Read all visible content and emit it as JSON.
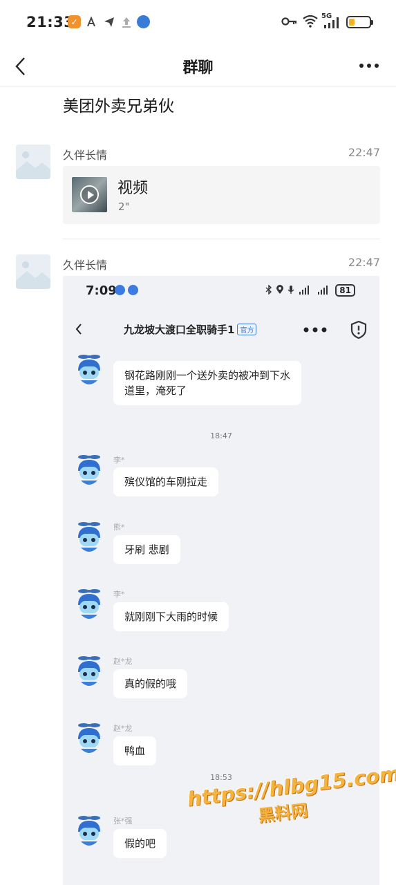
{
  "status_bar": {
    "time": "21:33",
    "network": "5G",
    "battery_level": 0.3
  },
  "header": {
    "title": "群聊",
    "back_icon": "chevron-left-icon",
    "more_icon": "more-horizontal-icon"
  },
  "group_name": "美团外卖兄弟伙",
  "messages": [
    {
      "sender": "久伴长情",
      "time": "22:47",
      "type": "video",
      "title": "视频",
      "duration": "2\""
    },
    {
      "sender": "久伴长情",
      "time": "22:47",
      "type": "image"
    }
  ],
  "screenshot": {
    "time": "7:09",
    "battery": "81",
    "chat_title": "九龙坡大渡口全职骑手1",
    "official_badge": "官方",
    "items": [
      {
        "kind": "msg",
        "name": "",
        "text_lines": [
          "钢花路刚刚一个送外卖的被冲到下水",
          "道里，淹死了"
        ]
      },
      {
        "kind": "stamp",
        "text": "18:47"
      },
      {
        "kind": "msg",
        "name": "李*",
        "text_lines": [
          "殡仪馆的车刚拉走"
        ]
      },
      {
        "kind": "msg",
        "name": "熊*",
        "text_lines": [
          "牙刷 悲剧"
        ]
      },
      {
        "kind": "msg",
        "name": "李*",
        "text_lines": [
          "就刚刚下大雨的时候"
        ]
      },
      {
        "kind": "msg",
        "name": "赵*龙",
        "text_lines": [
          "真的假的哦"
        ]
      },
      {
        "kind": "msg",
        "name": "赵*龙",
        "text_lines": [
          "鸭血"
        ]
      },
      {
        "kind": "stamp",
        "text": "18:53"
      },
      {
        "kind": "msg",
        "name": "张*强",
        "text_lines": [
          "假的吧"
        ]
      }
    ]
  },
  "watermark": {
    "url": "https://hlbg15.com",
    "label": "黑料网"
  },
  "colors": {
    "accent_blue": "#3a79d6",
    "watermark_orange": "#f4b33c",
    "battery_yellow": "#f5b025"
  }
}
